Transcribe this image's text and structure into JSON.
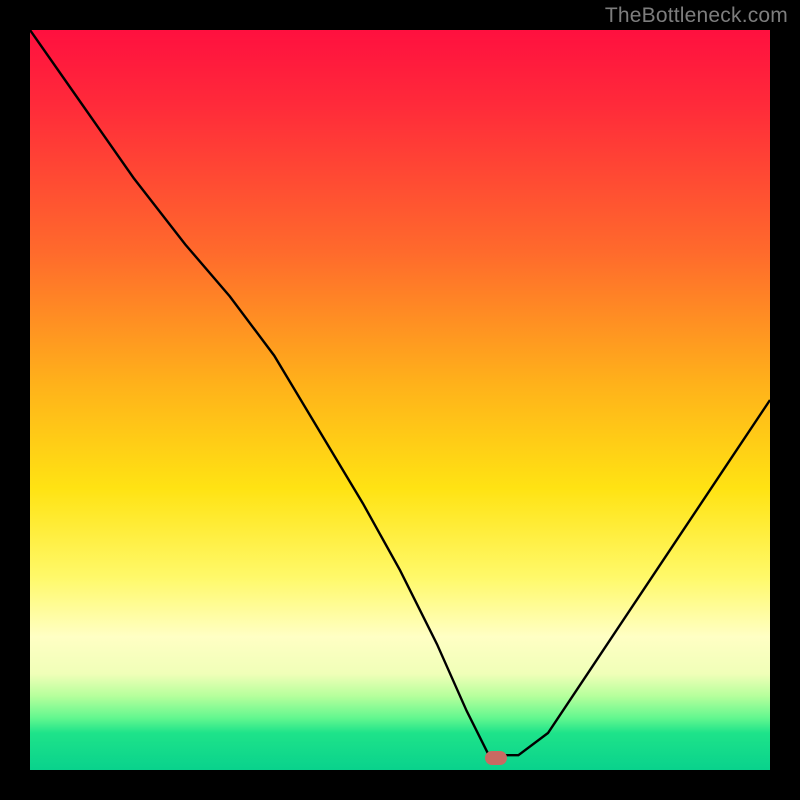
{
  "watermark": "TheBottleneck.com",
  "marker": {
    "x_frac": 0.63,
    "y_frac": 0.985
  },
  "chart_data": {
    "type": "line",
    "title": "",
    "xlabel": "",
    "ylabel": "",
    "xlim": [
      0,
      1
    ],
    "ylim": [
      0,
      1
    ],
    "series": [
      {
        "name": "curve",
        "x": [
          0.0,
          0.07,
          0.14,
          0.21,
          0.27,
          0.33,
          0.39,
          0.45,
          0.5,
          0.55,
          0.59,
          0.62,
          0.66,
          0.7,
          0.76,
          0.82,
          0.88,
          0.94,
          1.0
        ],
        "y": [
          1.0,
          0.9,
          0.8,
          0.71,
          0.64,
          0.56,
          0.46,
          0.36,
          0.27,
          0.17,
          0.08,
          0.02,
          0.02,
          0.05,
          0.14,
          0.23,
          0.32,
          0.41,
          0.5
        ]
      }
    ],
    "gradient_stops": [
      {
        "pos": 0.0,
        "color": "#ff103f"
      },
      {
        "pos": 0.3,
        "color": "#ff6a2c"
      },
      {
        "pos": 0.62,
        "color": "#ffe313"
      },
      {
        "pos": 0.85,
        "color": "#ffffc4"
      },
      {
        "pos": 0.93,
        "color": "#62f78f"
      },
      {
        "pos": 1.0,
        "color": "#09d28c"
      }
    ]
  }
}
